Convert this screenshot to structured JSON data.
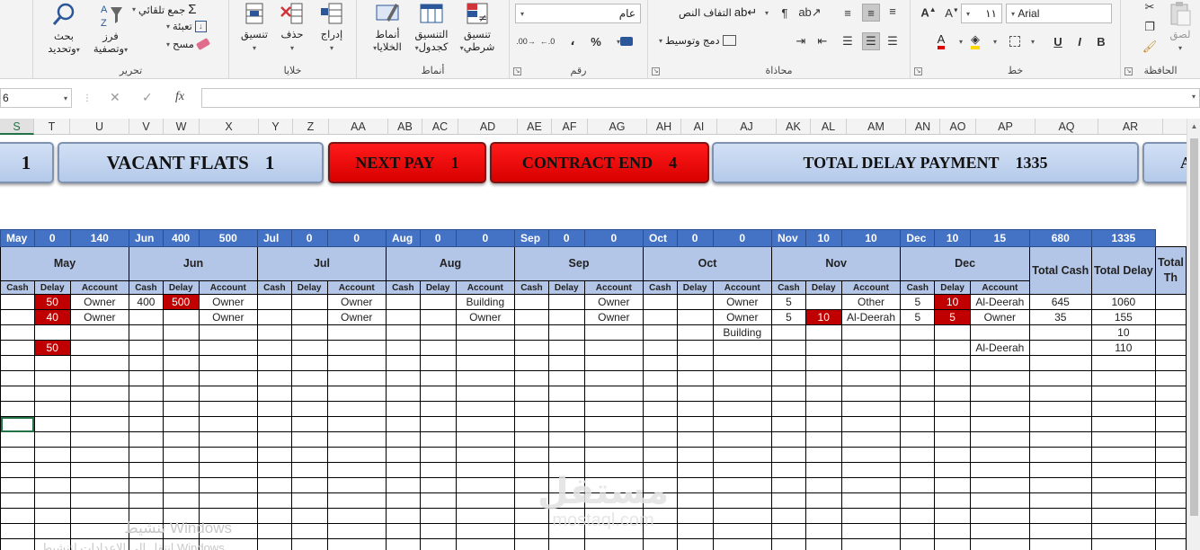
{
  "ribbon": {
    "editing": {
      "label": "تحرير",
      "find_select": [
        "بحث",
        "وتحديد"
      ],
      "sort_filter": [
        "فرز",
        "وتصفية"
      ],
      "autosum": "جمع تلقائي",
      "fill": "تعبئة",
      "clear": "مسح"
    },
    "cells": {
      "label": "خلايا",
      "format": "تنسيق",
      "delete": "حذف",
      "insert": "إدراج"
    },
    "styles": {
      "label": "أنماط",
      "cell_styles": [
        "أنماط",
        "الخلايا"
      ],
      "format_table": [
        "التنسيق",
        "كجدول"
      ],
      "conditional": [
        "تنسيق",
        "شرطي"
      ]
    },
    "number": {
      "label": "رقم",
      "format_value": "عام",
      "percent": "%",
      "comma": "،"
    },
    "alignment": {
      "label": "محاذاة",
      "wrap_text": "التفاف النص",
      "merge_center": "دمج وتوسيط"
    },
    "font": {
      "label": "خط",
      "font_name": "Arial",
      "font_size": "١١",
      "bold": "B",
      "italic": "I",
      "underline": "U"
    },
    "clipboard": {
      "label": "الحافظة",
      "paste": "لصق"
    }
  },
  "formula_bar": {
    "name_box": "6",
    "cancel": "✕",
    "enter": "✓",
    "fx": "fx",
    "formula": ""
  },
  "columns": [
    "S",
    "T",
    "U",
    "V",
    "W",
    "X",
    "Y",
    "Z",
    "AA",
    "AB",
    "AC",
    "AD",
    "AE",
    "AF",
    "AG",
    "AH",
    "AI",
    "AJ",
    "AK",
    "AL",
    "AM",
    "AN",
    "AO",
    "AP",
    "AQ",
    "AR",
    ""
  ],
  "kpis": {
    "partial": {
      "value": "1"
    },
    "vacant": {
      "label": "VACANT FLATS",
      "value": "1"
    },
    "next_pay": {
      "label": "NEXT PAY",
      "value": "1"
    },
    "contract_end": {
      "label": "CONTRACT END",
      "value": "4"
    },
    "total_delay": {
      "label": "TOTAL DELAY PAYMENT",
      "value": "1335"
    },
    "next_partial": {
      "label": "A"
    }
  },
  "months": [
    {
      "name": "May",
      "short": "May",
      "a": "0",
      "b": "140"
    },
    {
      "name": "Jun",
      "short": "Jun",
      "a": "400",
      "b": "500"
    },
    {
      "name": "Jul",
      "short": "Jul",
      "a": "0",
      "b": "0"
    },
    {
      "name": "Aug",
      "short": "Aug",
      "a": "0",
      "b": "0"
    },
    {
      "name": "Sep",
      "short": "Sep",
      "a": "0",
      "b": "0"
    },
    {
      "name": "Oct",
      "short": "Oct",
      "a": "0",
      "b": "0"
    },
    {
      "name": "Nov",
      "short": "Nov",
      "a": "10",
      "b": "10"
    },
    {
      "name": "Dec",
      "short": "Dec",
      "a": "10",
      "b": "15"
    }
  ],
  "totals_header": {
    "cash_total": "680",
    "delay_total": "1335",
    "total_cash_label": "Total Cash",
    "total_delay_label": "Total Delay",
    "total_third_label": "Total Th"
  },
  "sub_headers": {
    "cash": "Cash",
    "delay": "Delay",
    "account": "Account"
  },
  "rows": [
    [
      "",
      "50",
      "Owner",
      "400",
      "500",
      "Owner",
      "",
      "",
      "Owner",
      "",
      "",
      "Building",
      "",
      "",
      "Owner",
      "",
      "",
      "Owner",
      "5",
      "",
      "Other",
      "5",
      "10",
      "Al-Deerah",
      "645",
      "1060",
      ""
    ],
    [
      "",
      "40",
      "Owner",
      "",
      "",
      "Owner",
      "",
      "",
      "Owner",
      "",
      "",
      "Owner",
      "",
      "",
      "Owner",
      "",
      "",
      "Owner",
      "5",
      "10",
      "Al-Deerah",
      "5",
      "5",
      "Owner",
      "35",
      "155",
      ""
    ],
    [
      "",
      "",
      "",
      "",
      "",
      "",
      "",
      "",
      "",
      "",
      "",
      "",
      "",
      "",
      "",
      "",
      "",
      "Building",
      "",
      "",
      "",
      "",
      "",
      "",
      "",
      "10",
      ""
    ],
    [
      "",
      "50",
      "",
      "",
      "",
      "",
      "",
      "",
      "",
      "",
      "",
      "",
      "",
      "",
      "",
      "",
      "",
      "",
      "",
      "",
      "",
      "",
      "",
      "Al-Deerah",
      "",
      "110",
      ""
    ]
  ],
  "red_cells": [
    [
      0,
      1
    ],
    [
      0,
      4
    ],
    [
      1,
      1
    ],
    [
      1,
      19
    ],
    [
      1,
      22
    ],
    [
      0,
      22
    ],
    [
      3,
      1
    ]
  ],
  "empty_rows": 14,
  "watermark": {
    "arabic": "مستقل",
    "latin": "mostaql.com"
  },
  "windows_activation": {
    "title": "تنشيط Windows",
    "subtitle": "انتقل إلى الإعدادات لتنشيط Windows."
  }
}
